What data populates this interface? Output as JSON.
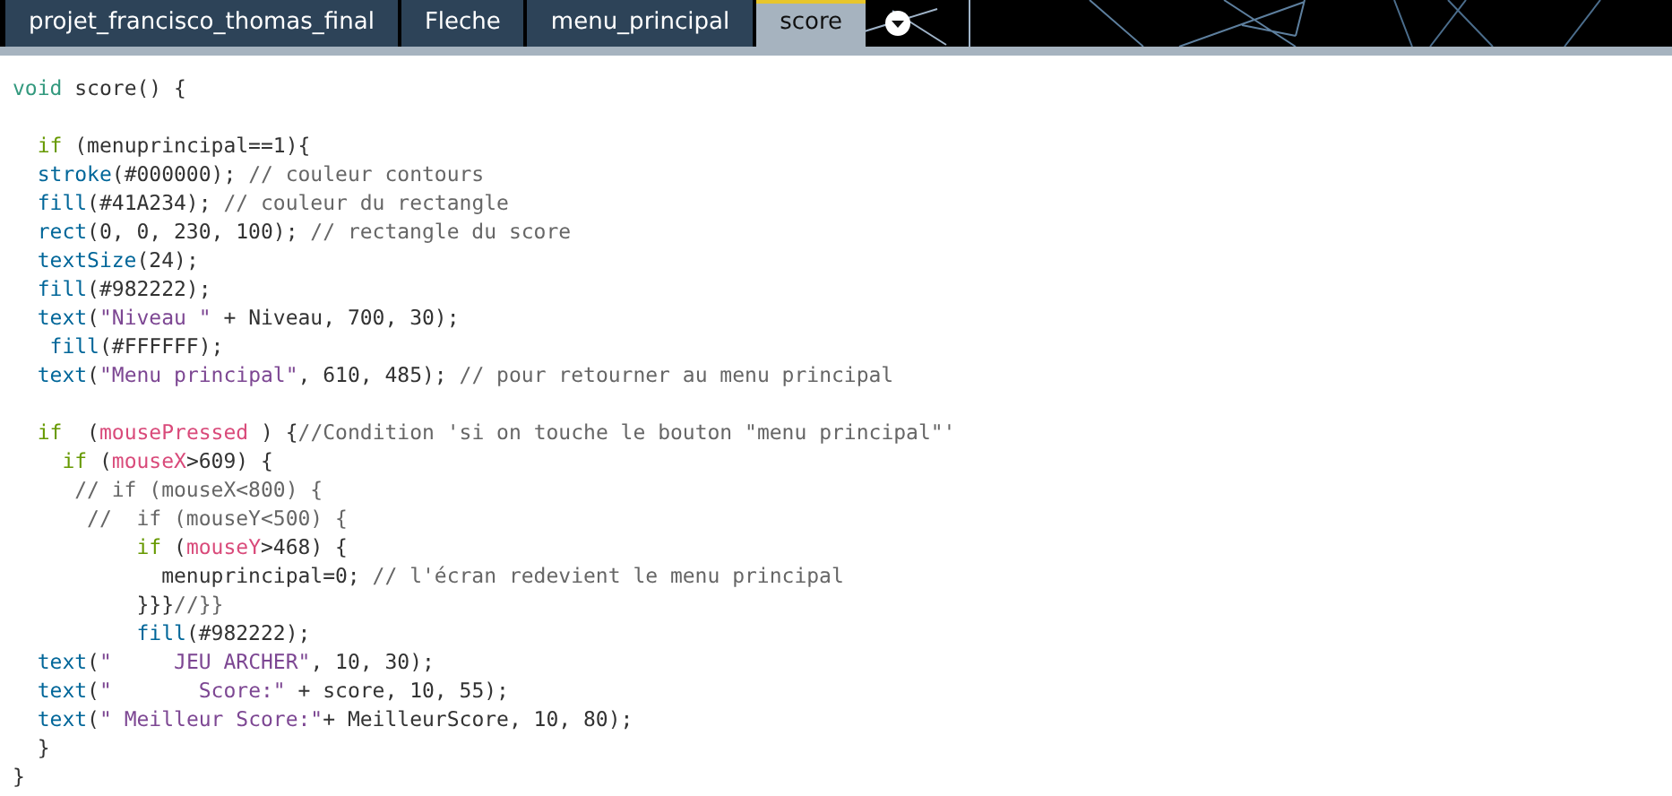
{
  "tabs": [
    {
      "label": "projet_francisco_thomas_final",
      "selected": false
    },
    {
      "label": "Fleche",
      "selected": false
    },
    {
      "label": "menu_principal",
      "selected": false
    },
    {
      "label": "score",
      "selected": true
    }
  ],
  "editor": {
    "lines": [
      {
        "kind": "code",
        "tokens": [
          {
            "kind": "type",
            "text": "void"
          },
          {
            "kind": "plain",
            "text": " score() {"
          }
        ]
      },
      {
        "kind": "blank"
      },
      {
        "kind": "code",
        "tokens": [
          {
            "kind": "keyword",
            "text": "  if"
          },
          {
            "kind": "plain",
            "text": " (menuprincipal==1){"
          }
        ]
      },
      {
        "kind": "code",
        "tokens": [
          {
            "kind": "function",
            "text": "  stroke"
          },
          {
            "kind": "plain",
            "text": "(#000000); "
          },
          {
            "kind": "comment",
            "text": "// couleur contours"
          }
        ]
      },
      {
        "kind": "code",
        "tokens": [
          {
            "kind": "function",
            "text": "  fill"
          },
          {
            "kind": "plain",
            "text": "(#41A234); "
          },
          {
            "kind": "comment",
            "text": "// couleur du rectangle"
          }
        ]
      },
      {
        "kind": "code",
        "tokens": [
          {
            "kind": "function",
            "text": "  rect"
          },
          {
            "kind": "plain",
            "text": "(0, 0, 230, 100); "
          },
          {
            "kind": "comment",
            "text": "// rectangle du score"
          }
        ]
      },
      {
        "kind": "code",
        "tokens": [
          {
            "kind": "function",
            "text": "  textSize"
          },
          {
            "kind": "plain",
            "text": "(24);"
          }
        ]
      },
      {
        "kind": "code",
        "tokens": [
          {
            "kind": "function",
            "text": "  fill"
          },
          {
            "kind": "plain",
            "text": "(#982222);"
          }
        ]
      },
      {
        "kind": "code",
        "tokens": [
          {
            "kind": "function",
            "text": "  text"
          },
          {
            "kind": "plain",
            "text": "("
          },
          {
            "kind": "string",
            "text": "\"Niveau \""
          },
          {
            "kind": "plain",
            "text": " + Niveau, 700, 30);"
          }
        ]
      },
      {
        "kind": "code",
        "tokens": [
          {
            "kind": "function",
            "text": "   fill"
          },
          {
            "kind": "plain",
            "text": "(#FFFFFF);"
          }
        ]
      },
      {
        "kind": "code",
        "tokens": [
          {
            "kind": "function",
            "text": "  text"
          },
          {
            "kind": "plain",
            "text": "("
          },
          {
            "kind": "string",
            "text": "\"Menu principal\""
          },
          {
            "kind": "plain",
            "text": ", 610, 485); "
          },
          {
            "kind": "comment",
            "text": "// pour retourner au menu principal"
          }
        ]
      },
      {
        "kind": "blank"
      },
      {
        "kind": "code",
        "tokens": [
          {
            "kind": "keyword",
            "text": "  if"
          },
          {
            "kind": "plain",
            "text": "  ("
          },
          {
            "kind": "variable",
            "text": "mousePressed"
          },
          {
            "kind": "plain",
            "text": " ) {"
          },
          {
            "kind": "comment",
            "text": "//Condition 'si on touche le bouton \"menu principal\"'"
          }
        ]
      },
      {
        "kind": "code",
        "tokens": [
          {
            "kind": "keyword",
            "text": "    if"
          },
          {
            "kind": "plain",
            "text": " ("
          },
          {
            "kind": "variable",
            "text": "mouseX"
          },
          {
            "kind": "plain",
            "text": ">609) {"
          }
        ]
      },
      {
        "kind": "code",
        "tokens": [
          {
            "kind": "comment",
            "text": "     // if (mouseX<800) {"
          }
        ]
      },
      {
        "kind": "code",
        "tokens": [
          {
            "kind": "comment",
            "text": "      //  if (mouseY<500) {"
          }
        ]
      },
      {
        "kind": "code",
        "tokens": [
          {
            "kind": "keyword",
            "text": "          if"
          },
          {
            "kind": "plain",
            "text": " ("
          },
          {
            "kind": "variable",
            "text": "mouseY"
          },
          {
            "kind": "plain",
            "text": ">468) {"
          }
        ]
      },
      {
        "kind": "code",
        "tokens": [
          {
            "kind": "plain",
            "text": "            menuprincipal=0; "
          },
          {
            "kind": "comment",
            "text": "// l'écran redevient le menu principal"
          }
        ]
      },
      {
        "kind": "code",
        "tokens": [
          {
            "kind": "plain",
            "text": "          }}}"
          },
          {
            "kind": "comment",
            "text": "//}}"
          }
        ]
      },
      {
        "kind": "code",
        "tokens": [
          {
            "kind": "function",
            "text": "          fill"
          },
          {
            "kind": "plain",
            "text": "(#982222);"
          }
        ]
      },
      {
        "kind": "code",
        "tokens": [
          {
            "kind": "function",
            "text": "  text"
          },
          {
            "kind": "plain",
            "text": "("
          },
          {
            "kind": "string",
            "text": "\"     JEU ARCHER\""
          },
          {
            "kind": "plain",
            "text": ", 10, 30);"
          }
        ]
      },
      {
        "kind": "code",
        "tokens": [
          {
            "kind": "function",
            "text": "  text"
          },
          {
            "kind": "plain",
            "text": "("
          },
          {
            "kind": "string",
            "text": "\"       Score:\""
          },
          {
            "kind": "plain",
            "text": " + score, 10, 55);"
          }
        ]
      },
      {
        "kind": "code",
        "tokens": [
          {
            "kind": "function",
            "text": "  text"
          },
          {
            "kind": "plain",
            "text": "("
          },
          {
            "kind": "string",
            "text": "\" Meilleur Score:\""
          },
          {
            "kind": "plain",
            "text": "+ MeilleurScore, 10, 80);"
          }
        ]
      },
      {
        "kind": "code",
        "tokens": [
          {
            "kind": "plain",
            "text": "  }"
          }
        ]
      },
      {
        "kind": "code",
        "tokens": [
          {
            "kind": "plain",
            "text": "}"
          }
        ]
      }
    ]
  }
}
